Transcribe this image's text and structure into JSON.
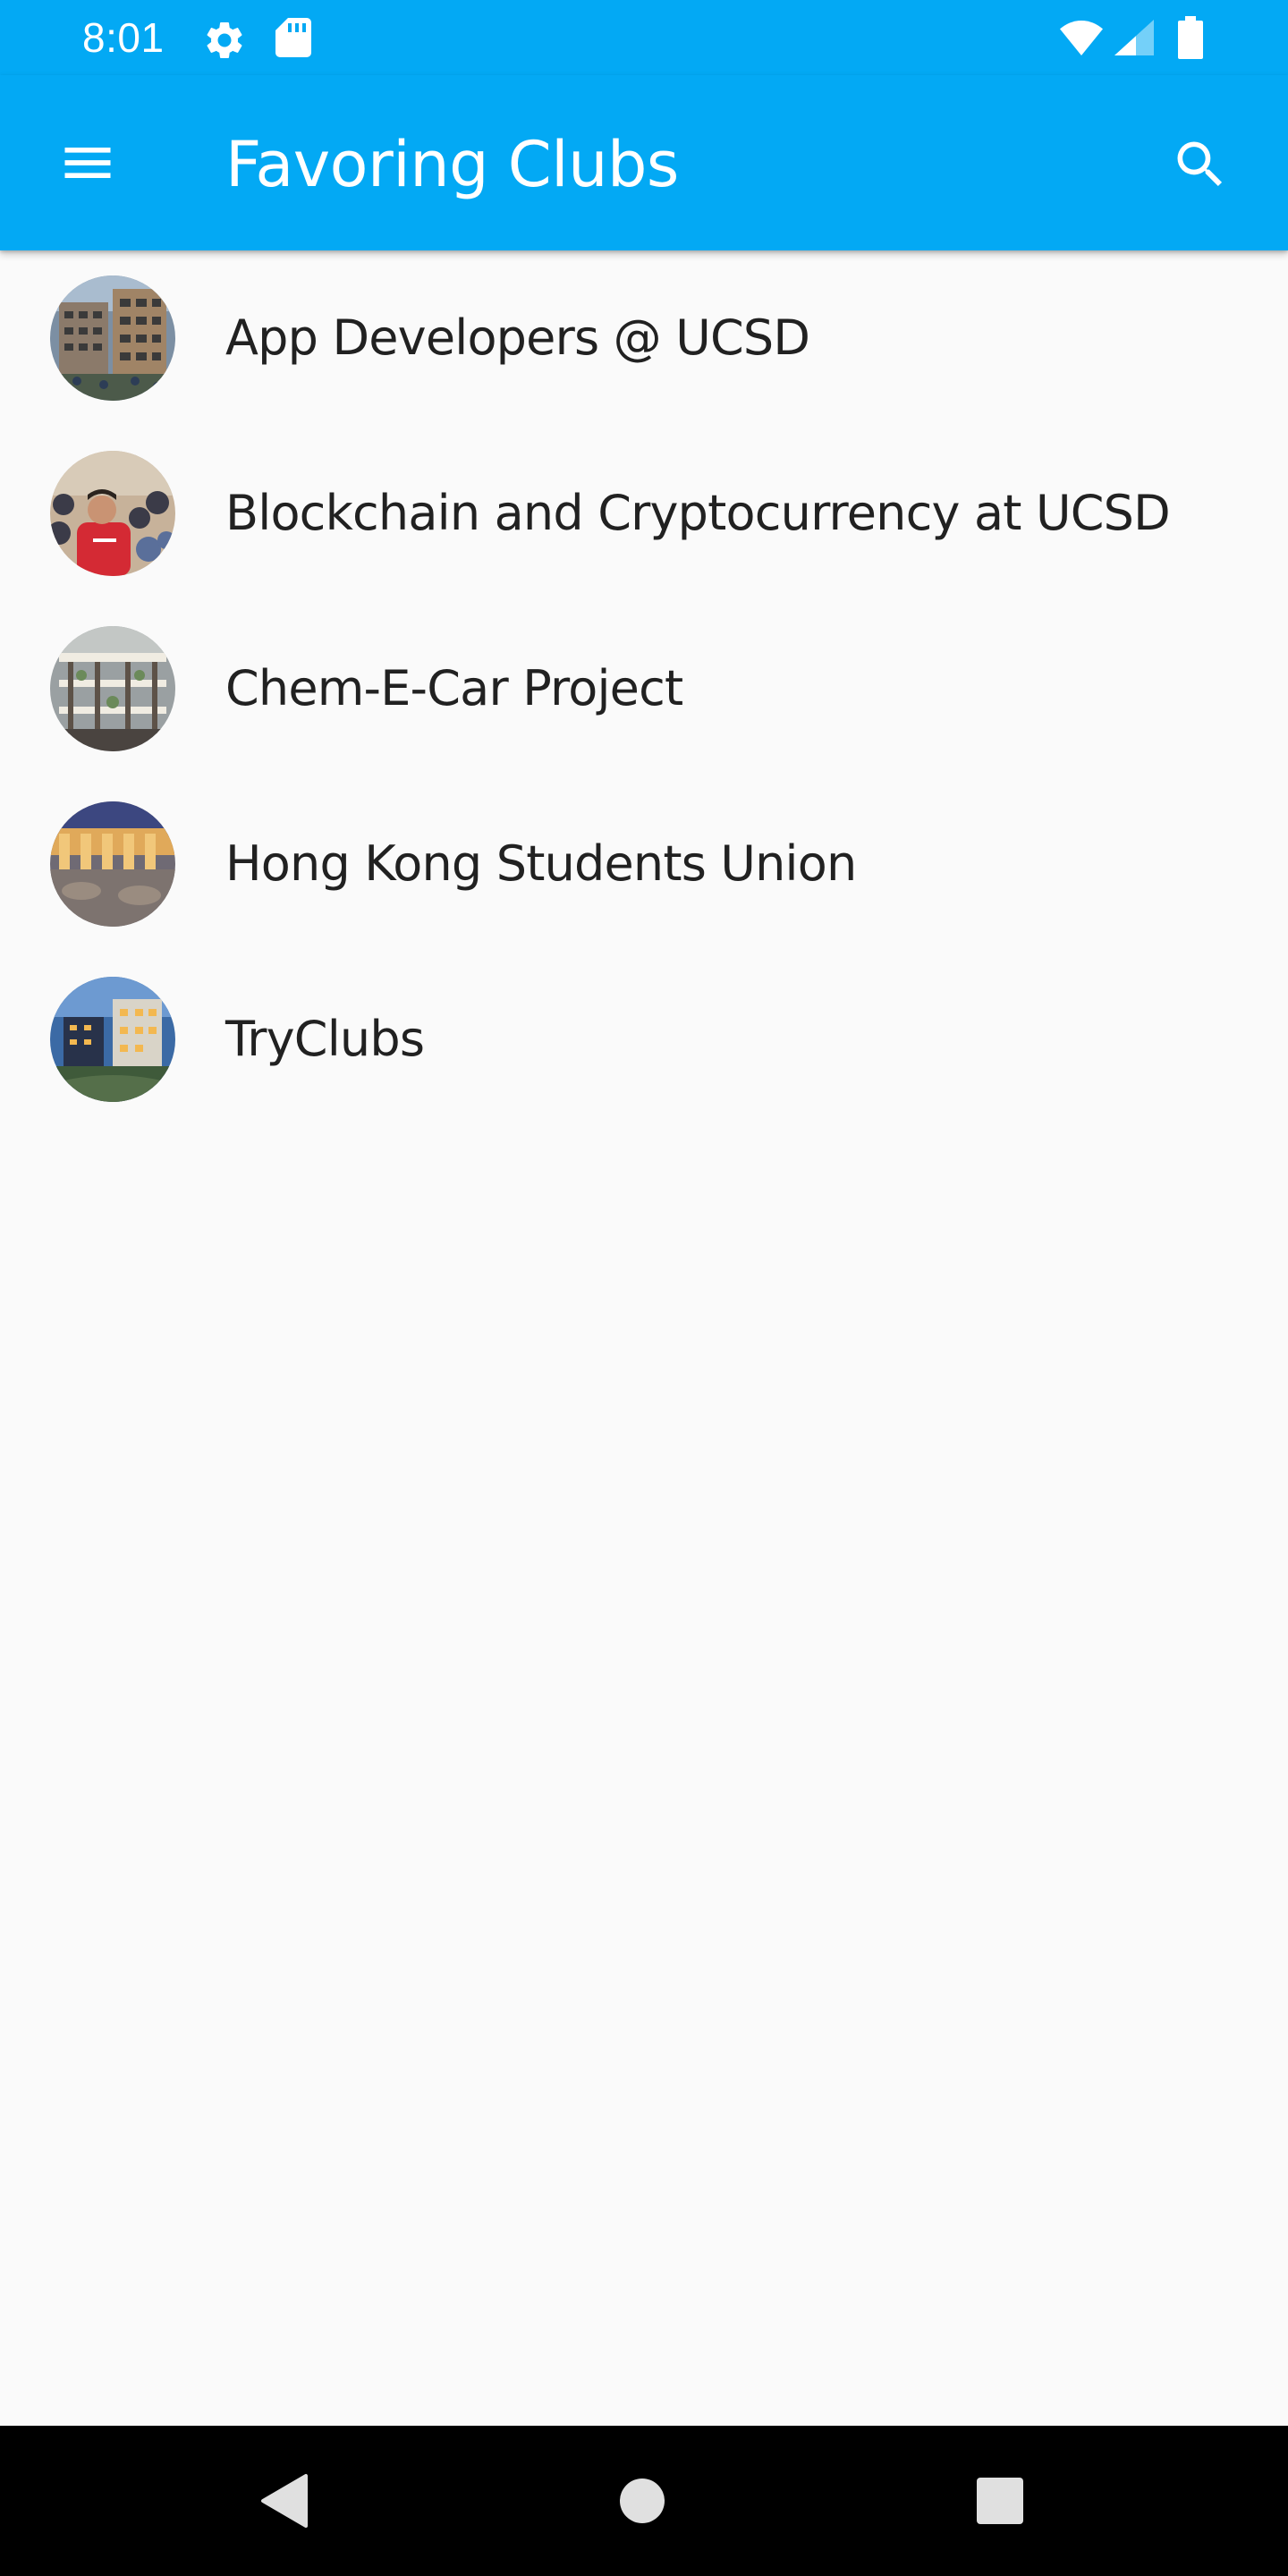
{
  "status_bar": {
    "time": "8:01",
    "icons": [
      "gear-icon",
      "sd-card-icon",
      "wifi-icon",
      "cell-signal-icon",
      "battery-icon"
    ]
  },
  "app_bar": {
    "title": "Favoring Clubs",
    "menu_icon": "hamburger-menu-icon",
    "search_icon": "search-icon",
    "color": "#03a9f4"
  },
  "clubs": [
    {
      "name": "App Developers @ UCSD"
    },
    {
      "name": "Blockchain and Cryptocurrency at UCSD"
    },
    {
      "name": "Chem-E-Car Project"
    },
    {
      "name": "Hong Kong Students Union"
    },
    {
      "name": "TryClubs"
    }
  ],
  "nav_bar": {
    "buttons": [
      "back-triangle-icon",
      "home-circle-icon",
      "recents-square-icon"
    ]
  }
}
